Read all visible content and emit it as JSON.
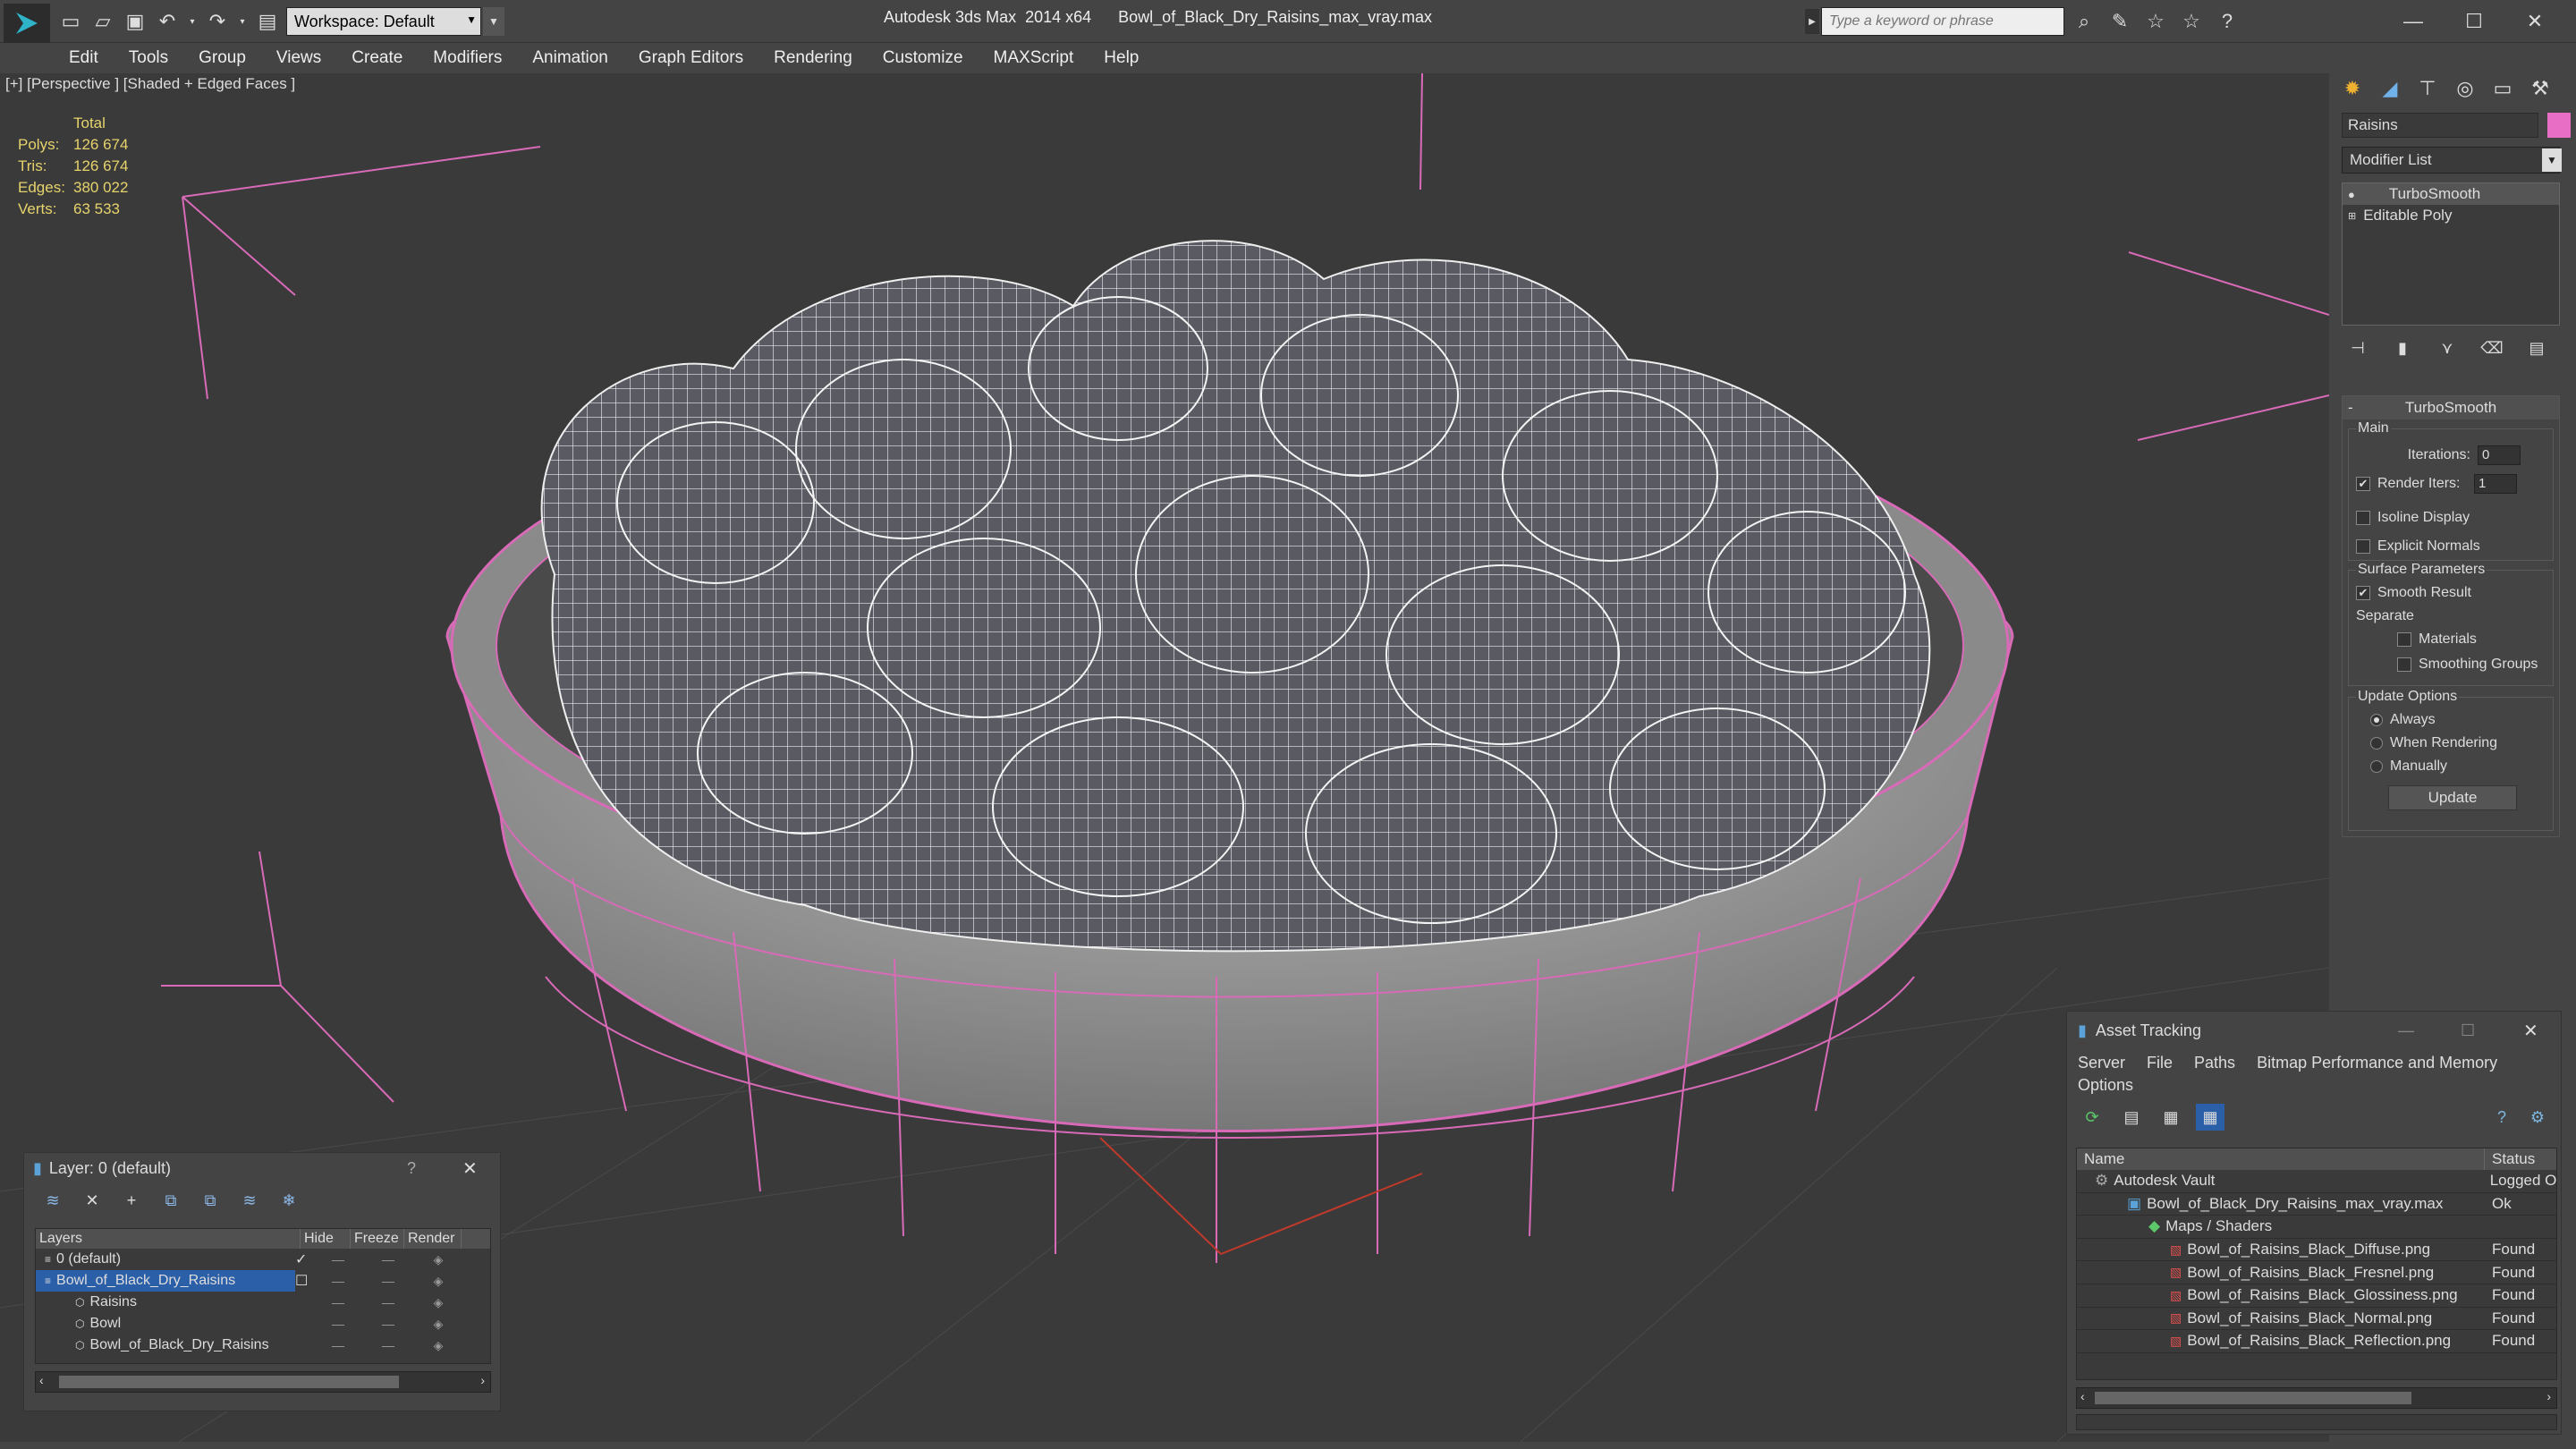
{
  "app": {
    "title": "Autodesk 3ds Max  2014 x64      Bowl_of_Black_Dry_Raisins_max_vray.max",
    "workspace": "Workspace: Default",
    "search_placeholder": "Type a keyword or phrase"
  },
  "menu": [
    "Edit",
    "Tools",
    "Group",
    "Views",
    "Create",
    "Modifiers",
    "Animation",
    "Graph Editors",
    "Rendering",
    "Customize",
    "MAXScript",
    "Help"
  ],
  "viewport": {
    "label": "[+] [Perspective ] [Shaded + Edged Faces ]",
    "stats_header": "Total",
    "stats": [
      {
        "k": "Polys:",
        "v": "126 674"
      },
      {
        "k": "Tris:",
        "v": "126 674"
      },
      {
        "k": "Edges:",
        "v": "380 022"
      },
      {
        "k": "Verts:",
        "v": "63 533"
      }
    ]
  },
  "command_panel": {
    "object_name": "Raisins",
    "object_color": "#e86dc5",
    "modifier_list": "Modifier List",
    "stack": [
      "TurboSmooth",
      "Editable Poly"
    ],
    "rollout": {
      "title": "TurboSmooth",
      "main_label": "Main",
      "iterations_label": "Iterations:",
      "iterations": "0",
      "render_iters_label": "Render Iters:",
      "render_iters": "1",
      "isoline": "Isoline Display",
      "explicit_normals": "Explicit Normals",
      "surface_label": "Surface Parameters",
      "smooth_result": "Smooth Result",
      "separate_label": "Separate",
      "materials": "Materials",
      "smoothing_groups": "Smoothing Groups",
      "update_options": "Update Options",
      "always": "Always",
      "when_rendering": "When Rendering",
      "manually": "Manually",
      "update_button": "Update"
    }
  },
  "layer_window": {
    "title": "Layer: 0 (default)",
    "help": "?",
    "columns": [
      "Layers",
      "Hide",
      "Freeze",
      "Render"
    ],
    "rows": [
      {
        "name": "0 (default)",
        "indent": 0,
        "selected": false
      },
      {
        "name": "Bowl_of_Black_Dry_Raisins",
        "indent": 0,
        "selected": true
      },
      {
        "name": "Raisins",
        "indent": 1,
        "selected": false
      },
      {
        "name": "Bowl",
        "indent": 1,
        "selected": false
      },
      {
        "name": "Bowl_of_Black_Dry_Raisins",
        "indent": 1,
        "selected": false
      }
    ]
  },
  "asset_window": {
    "title": "Asset Tracking",
    "menu": [
      "Server",
      "File",
      "Paths",
      "Bitmap Performance and Memory"
    ],
    "options": "Options",
    "columns": [
      "Name",
      "Status"
    ],
    "rows": [
      {
        "name": "Autodesk Vault",
        "status": "Logged O",
        "indent": 0,
        "icon": "vault"
      },
      {
        "name": "Bowl_of_Black_Dry_Raisins_max_vray.max",
        "status": "Ok",
        "indent": 1,
        "icon": "max"
      },
      {
        "name": "Maps / Shaders",
        "status": "",
        "indent": 2,
        "icon": "maps"
      },
      {
        "name": "Bowl_of_Raisins_Black_Diffuse.png",
        "status": "Found",
        "indent": 3,
        "icon": "png"
      },
      {
        "name": "Bowl_of_Raisins_Black_Fresnel.png",
        "status": "Found",
        "indent": 3,
        "icon": "png"
      },
      {
        "name": "Bowl_of_Raisins_Black_Glossiness.png",
        "status": "Found",
        "indent": 3,
        "icon": "png"
      },
      {
        "name": "Bowl_of_Raisins_Black_Normal.png",
        "status": "Found",
        "indent": 3,
        "icon": "png"
      },
      {
        "name": "Bowl_of_Raisins_Black_Reflection.png",
        "status": "Found",
        "indent": 3,
        "icon": "png"
      }
    ]
  }
}
